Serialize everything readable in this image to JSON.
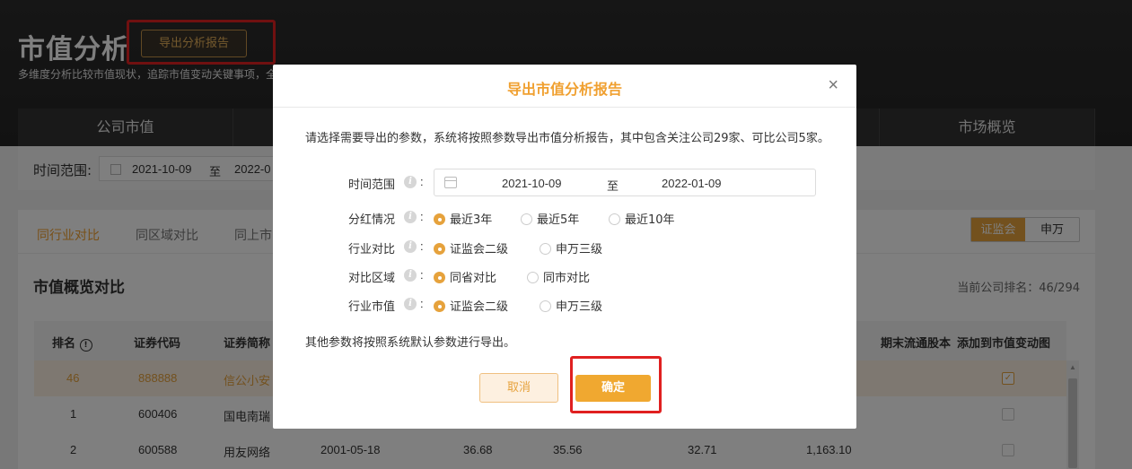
{
  "page": {
    "title": "市值分析",
    "export_button": "导出分析报告",
    "subtitle": "多维度分析比较市值现状，追踪市值变动关键事项，全"
  },
  "nav": {
    "tabs": [
      "公司市值",
      "市场概览"
    ]
  },
  "time_filter": {
    "label": "时间范围:",
    "start": "2021-10-09",
    "sep": "至",
    "end": "2022-0"
  },
  "compare": {
    "tabs": [
      "同行业对比",
      "同区域对比",
      "同上市"
    ],
    "toggle": [
      "证监会",
      "申万"
    ],
    "section_title": "市值概览对比",
    "rank_label": "当前公司排名：46/294"
  },
  "table": {
    "headers": {
      "rank": "排名",
      "code": "证券代码",
      "name": "证券简称",
      "circ": "期末流通股本",
      "add": "添加到市值变动图"
    },
    "rows": [
      {
        "rank": "46",
        "code": "888888",
        "name": "信公小安",
        "date": "",
        "v1": "",
        "v2": "",
        "v3": "",
        "v4": "",
        "checked": true,
        "highlight": true
      },
      {
        "rank": "1",
        "code": "600406",
        "name": "国电南瑞",
        "date": "",
        "v1": "",
        "v2": "",
        "v3": "",
        "v4": "",
        "checked": false,
        "highlight": false
      },
      {
        "rank": "2",
        "code": "600588",
        "name": "用友网络",
        "date": "2001-05-18",
        "v1": "36.68",
        "v2": "35.56",
        "v3": "32.71",
        "v4": "1,163.10",
        "checked": false,
        "highlight": false
      }
    ]
  },
  "dialog": {
    "title": "导出市值分析报告",
    "close": "×",
    "description": "请选择需要导出的参数，系统将按照参数导出市值分析报告，其中包含关注公司29家、可比公司5家。",
    "time_range_label": "时间范围",
    "date_start": "2021-10-09",
    "date_sep": "至",
    "date_end": "2022-01-09",
    "fields": [
      {
        "label": "分红情况",
        "options": [
          "最近3年",
          "最近5年",
          "最近10年"
        ],
        "selected": 0
      },
      {
        "label": "行业对比",
        "options": [
          "证监会二级",
          "申万三级"
        ],
        "selected": 0
      },
      {
        "label": "对比区域",
        "options": [
          "同省对比",
          "同市对比"
        ],
        "selected": 0
      },
      {
        "label": "行业市值",
        "options": [
          "证监会二级",
          "申万三级"
        ],
        "selected": 0
      }
    ],
    "note": "其他参数将按照系统默认参数进行导出。",
    "cancel": "取消",
    "confirm": "确定"
  },
  "colors": {
    "accent": "#e6a23c",
    "highlight_box": "#e02020",
    "header_bg": "#2c2c2c"
  }
}
